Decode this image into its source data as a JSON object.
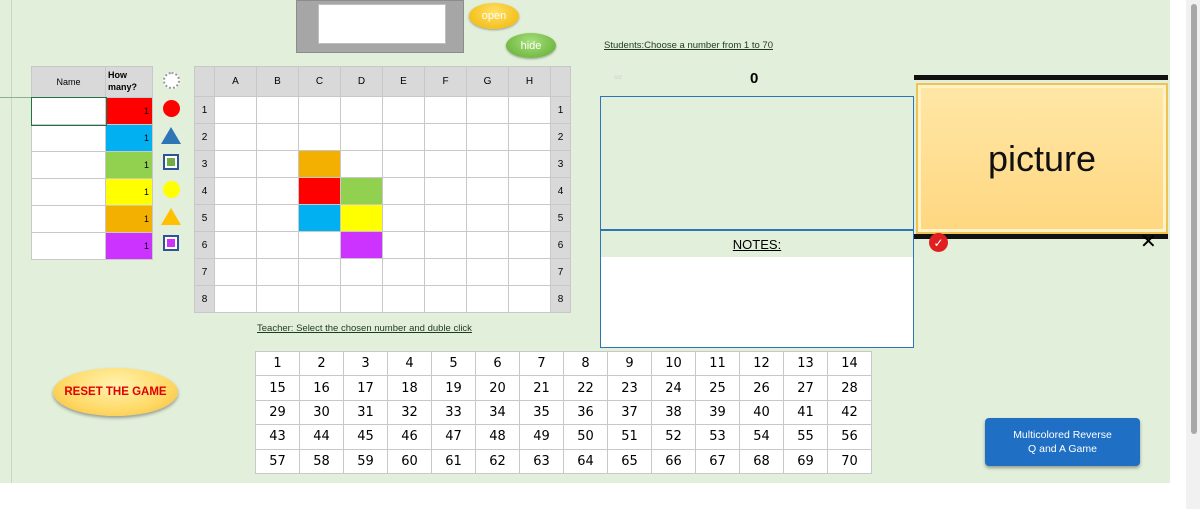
{
  "top_panel": {
    "open_label": "open",
    "hide_label": "hide"
  },
  "students_instruction": "Students:Choose a number from 1 to 70",
  "name_table": {
    "header_name": "Name",
    "header_how_many": "How many?",
    "rows": [
      {
        "color": "#ff0000",
        "count": "1",
        "shape": "circle-icon",
        "shape_color": "#ff0000"
      },
      {
        "color": "#00b0f0",
        "count": "1",
        "shape": "triangle-icon",
        "shape_color": "#2e75b6"
      },
      {
        "color": "#92d050",
        "count": "1",
        "shape": "square-icon",
        "shape_color": "#70ad47"
      },
      {
        "color": "#ffff00",
        "count": "1",
        "shape": "circle-icon",
        "shape_color": "#ffff00"
      },
      {
        "color": "#f4b000",
        "count": "1",
        "shape": "triangle-icon",
        "shape_color": "#ffc000"
      },
      {
        "color": "#cc33ff",
        "count": "1",
        "shape": "square-icon",
        "shape_color": "#cc33ff"
      }
    ]
  },
  "grid": {
    "columns": [
      "A",
      "B",
      "C",
      "D",
      "E",
      "F",
      "G",
      "H"
    ],
    "rows": [
      "1",
      "2",
      "3",
      "4",
      "5",
      "6",
      "7",
      "8"
    ],
    "colored_cells": [
      {
        "row": 3,
        "col": 3,
        "color": "#f4b000"
      },
      {
        "row": 4,
        "col": 3,
        "color": "#ff0000"
      },
      {
        "row": 4,
        "col": 4,
        "color": "#92d050"
      },
      {
        "row": 5,
        "col": 3,
        "color": "#00b0f0"
      },
      {
        "row": 5,
        "col": 4,
        "color": "#ffff00"
      },
      {
        "row": 6,
        "col": 4,
        "color": "#cc33ff"
      }
    ]
  },
  "teacher_instruction": "Teacher: Select the chosen number and duble click",
  "number_board": [
    [
      "1",
      "2",
      "3",
      "4",
      "5",
      "6",
      "7",
      "8",
      "9",
      "10",
      "11",
      "12",
      "13",
      "14"
    ],
    [
      "15",
      "16",
      "17",
      "18",
      "19",
      "20",
      "21",
      "22",
      "23",
      "24",
      "25",
      "26",
      "27",
      "28"
    ],
    [
      "29",
      "30",
      "31",
      "32",
      "33",
      "34",
      "35",
      "36",
      "37",
      "38",
      "39",
      "40",
      "41",
      "42"
    ],
    [
      "43",
      "44",
      "45",
      "46",
      "47",
      "48",
      "49",
      "50",
      "51",
      "52",
      "53",
      "54",
      "55",
      "56"
    ],
    [
      "57",
      "58",
      "59",
      "60",
      "61",
      "62",
      "63",
      "64",
      "65",
      "66",
      "67",
      "68",
      "69",
      "70"
    ]
  ],
  "reset_label": "RESET THE GAME",
  "score_label": "scr",
  "score_value": "0",
  "notes_label": "NOTES:",
  "picture_label": "picture",
  "game_title": "Multicolored Reverse\nQ and A Game",
  "colors": {
    "sheet_bg": "#e2efda",
    "accent_blue": "#2e75b6",
    "reset_text": "#e00000"
  }
}
